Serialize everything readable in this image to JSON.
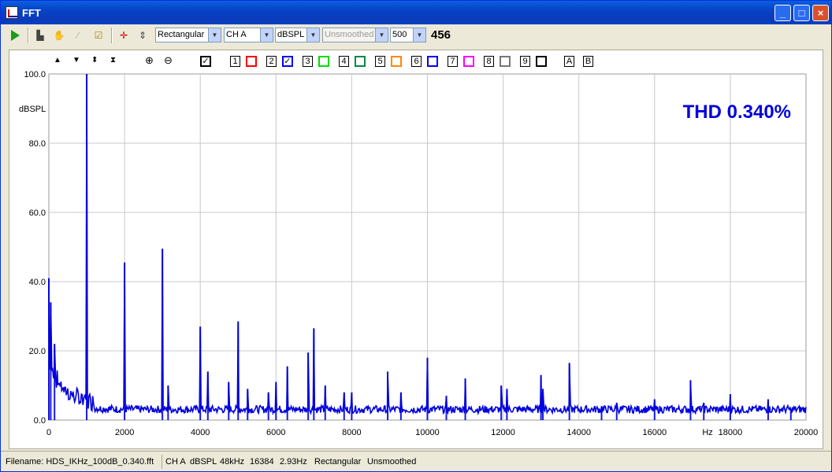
{
  "window": {
    "title": "FFT",
    "min_label": "_",
    "max_label": "□",
    "close_label": "×"
  },
  "toolbar": {
    "play_icon": "play-icon",
    "window_function": "Rectangular",
    "channel": "CH A",
    "units": "dBSPL",
    "smoothing": "Unsmoothed",
    "averages": "500",
    "count": "456"
  },
  "traces": {
    "tools": [
      "▲",
      "▼",
      "⬍",
      "⧗"
    ],
    "main_check": "✓",
    "items": [
      {
        "num": "1",
        "color": "#ff0000",
        "checked": ""
      },
      {
        "num": "2",
        "color": "#0000ff",
        "checked": "✓"
      },
      {
        "num": "3",
        "color": "#00dd00",
        "checked": ""
      },
      {
        "num": "4",
        "color": "#008844",
        "checked": ""
      },
      {
        "num": "5",
        "color": "#ff8800",
        "checked": ""
      },
      {
        "num": "6",
        "color": "#0000ff",
        "checked": ""
      },
      {
        "num": "7",
        "color": "#ff00ff",
        "checked": ""
      },
      {
        "num": "8",
        "color": "#777777",
        "checked": ""
      },
      {
        "num": "9",
        "color": "#000000",
        "checked": ""
      }
    ],
    "letters": [
      "A",
      "B"
    ]
  },
  "chart_data": {
    "type": "line",
    "xlabel": "Hz",
    "ylabel": "dBSPL",
    "xlim": [
      0,
      20000
    ],
    "ylim": [
      0,
      100
    ],
    "x_ticks": [
      "0",
      "2000",
      "4000",
      "6000",
      "8000",
      "10000",
      "12000",
      "14000",
      "16000",
      "Hz",
      "18000",
      "20000"
    ],
    "y_ticks": [
      "100.0",
      "80.0",
      "60.0",
      "40.0",
      "20.0",
      "0.0"
    ],
    "grid": true,
    "annotation": "THD 0.340%",
    "series_color": "#0000dd",
    "peaks": [
      {
        "x": 0,
        "y": 41
      },
      {
        "x": 50,
        "y": 34
      },
      {
        "x": 150,
        "y": 22
      },
      {
        "x": 1000,
        "y": 100
      },
      {
        "x": 2000,
        "y": 45.5
      },
      {
        "x": 3000,
        "y": 49.5
      },
      {
        "x": 3150,
        "y": 10
      },
      {
        "x": 4000,
        "y": 27
      },
      {
        "x": 4200,
        "y": 14
      },
      {
        "x": 4750,
        "y": 11
      },
      {
        "x": 5000,
        "y": 28.5
      },
      {
        "x": 5250,
        "y": 9
      },
      {
        "x": 5800,
        "y": 8
      },
      {
        "x": 6000,
        "y": 11
      },
      {
        "x": 6300,
        "y": 15.5
      },
      {
        "x": 6850,
        "y": 19.5
      },
      {
        "x": 7000,
        "y": 26.5
      },
      {
        "x": 7300,
        "y": 10
      },
      {
        "x": 7800,
        "y": 8
      },
      {
        "x": 8000,
        "y": 8
      },
      {
        "x": 8950,
        "y": 14
      },
      {
        "x": 9300,
        "y": 8
      },
      {
        "x": 10000,
        "y": 18
      },
      {
        "x": 10500,
        "y": 7
      },
      {
        "x": 11000,
        "y": 12
      },
      {
        "x": 11950,
        "y": 10
      },
      {
        "x": 12100,
        "y": 9
      },
      {
        "x": 13000,
        "y": 13
      },
      {
        "x": 13050,
        "y": 9
      },
      {
        "x": 13750,
        "y": 16.5
      },
      {
        "x": 14600,
        "y": 4
      },
      {
        "x": 15000,
        "y": 5
      },
      {
        "x": 16000,
        "y": 6
      },
      {
        "x": 16950,
        "y": 11.5
      },
      {
        "x": 17300,
        "y": 5
      },
      {
        "x": 18000,
        "y": 7.5
      },
      {
        "x": 19000,
        "y": 6
      },
      {
        "x": 19600,
        "y": 3
      }
    ]
  },
  "status": {
    "filename": "Filename: HDS_IKHz_100dB_0.340.fft",
    "channel": "CH A",
    "units": "dBSPL",
    "rate": "48kHz",
    "fft_size": "16384",
    "resolution": "2.93Hz",
    "window": "Rectangular",
    "smoothing": "Unsmoothed"
  }
}
